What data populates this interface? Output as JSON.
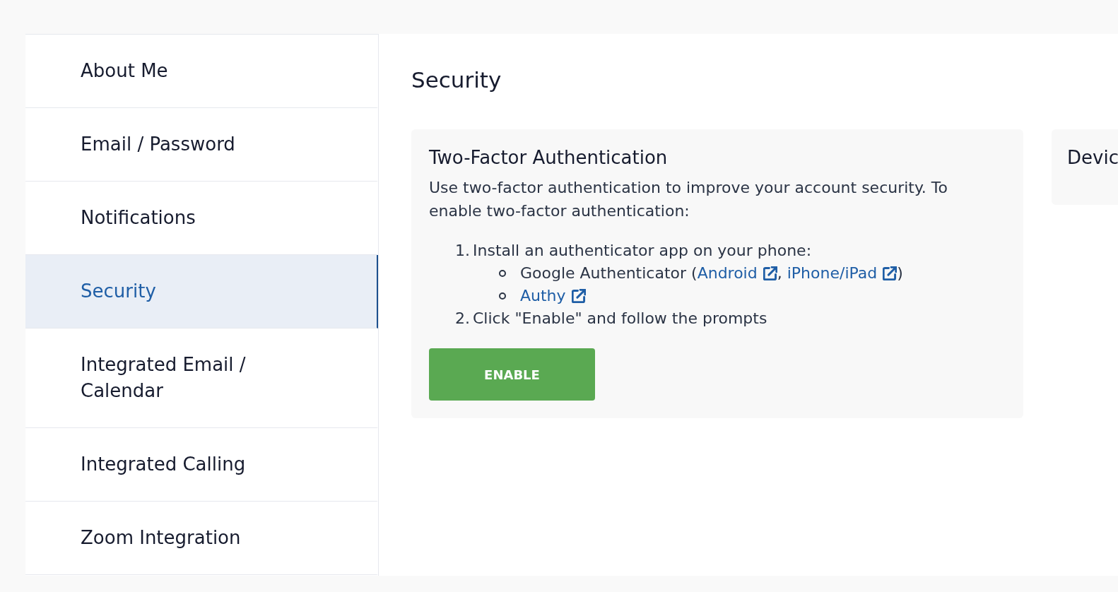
{
  "sidebar": {
    "items": [
      {
        "label": "About Me",
        "selected": false
      },
      {
        "label": "Email / Password",
        "selected": false
      },
      {
        "label": "Notifications",
        "selected": false
      },
      {
        "label": "Security",
        "selected": true
      },
      {
        "label": "Integrated Email / Calendar",
        "selected": false
      },
      {
        "label": "Integrated Calling",
        "selected": false
      },
      {
        "label": "Zoom Integration",
        "selected": false
      }
    ]
  },
  "page": {
    "title": "Security"
  },
  "cards": [
    {
      "kind": "two_factor",
      "title": "Two-Factor Authentication",
      "description": "Use two-factor authentication to improve your account security. To enable two-factor authentication:",
      "steps": [
        {
          "number": "1.",
          "text": "Install an authenticator app on your phone:",
          "children": [
            {
              "parts": [
                {
                  "kind": "text",
                  "text": "Google Authenticator ("
                },
                {
                  "kind": "link",
                  "text": "Android",
                  "external": true
                },
                {
                  "kind": "text",
                  "text": ", "
                },
                {
                  "kind": "link",
                  "text": "iPhone/iPad",
                  "external": true
                },
                {
                  "kind": "text",
                  "text": ")"
                }
              ]
            },
            {
              "parts": [
                {
                  "kind": "link",
                  "text": "Authy",
                  "external": true
                }
              ]
            }
          ]
        },
        {
          "number": "2.",
          "text": "Click \"Enable\" and follow the prompts"
        }
      ],
      "button": {
        "label": "ENABLE"
      }
    },
    {
      "kind": "device",
      "title": "Devic"
    }
  ]
}
